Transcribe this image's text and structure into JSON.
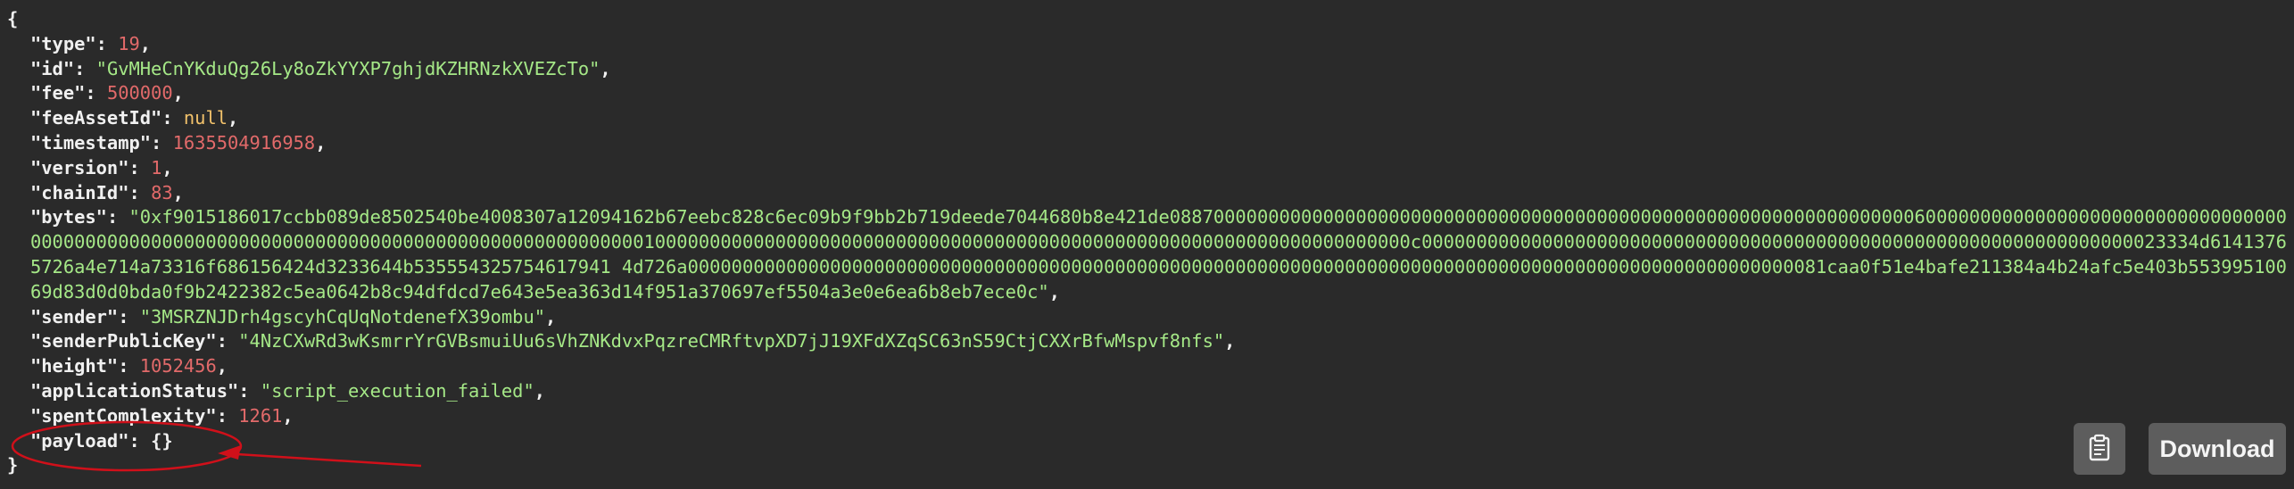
{
  "json_view": {
    "open_brace": "{",
    "close_brace": "}",
    "fields": {
      "type": {
        "key": "\"type\"",
        "value": "19"
      },
      "id": {
        "key": "\"id\"",
        "value": "\"GvMHeCnYKduQg26Ly8oZkYYXP7ghjdKZHRNzkXVEZcTo\""
      },
      "fee": {
        "key": "\"fee\"",
        "value": "500000"
      },
      "feeAssetId": {
        "key": "\"feeAssetId\"",
        "value": "null"
      },
      "timestamp": {
        "key": "\"timestamp\"",
        "value": "1635504916958"
      },
      "version": {
        "key": "\"version\"",
        "value": "1"
      },
      "chainId": {
        "key": "\"chainId\"",
        "value": "83"
      },
      "bytes": {
        "key": "\"bytes\"",
        "value": "\"0xf9015186017ccbb089de8502540be4008307a12094162b67eebc828c6ec09b9f9bb2b719deede7044680b8e421de088700000000000000000000000000000000000000000000000000000000000000006000000000000000000000000000000000000000000000000000000000000000000000000000000000000000001000000000000000000000000000000000000000000000000000000000000000000000c00000000000000000000000000000000000000000000000000000000000000000023334d61413765726a4e714a73316f686156424d3233644b535554325754617941 4d726a00000000000000000000000000000000000000000000000000000000000000000000000000000000000000000000000000000081caa0f51e4bafe211384a4b24afc5e403b55399510069d83d0d0bda0f9b2422382c5ea0642b8c94dfdcd7e643e5ea363d14f951a370697ef5504a3e0e6ea6b8eb7ece0c\""
      },
      "sender": {
        "key": "\"sender\"",
        "value": "\"3MSRZNJDrh4gscyhCqUqNotdenefX39ombu\""
      },
      "senderPublicKey": {
        "key": "\"senderPublicKey\"",
        "value": "\"4NzCXwRd3wKsmrrYrGVBsmuiUu6sVhZNKdvxPqzreCMRftvpXD7jJ19XFdXZqSC63nS59CtjCXXrBfwMspvf8nfs\""
      },
      "height": {
        "key": "\"height\"",
        "value": "1052456"
      },
      "applicationStatus": {
        "key": "\"applicationStatus\"",
        "value": "\"script_execution_failed\""
      },
      "spentComplexity": {
        "key": "\"spentComplexity\"",
        "value": "1261"
      },
      "payload": {
        "key": "\"payload\"",
        "value": "{}"
      }
    }
  },
  "toolbar": {
    "copy_icon": "clipboard-icon",
    "download_label": "Download"
  },
  "colors": {
    "background": "#2a2a2a",
    "string": "#a5e887",
    "number": "#e26a6a",
    "null": "#f2c26b",
    "annotation": "#d0101a",
    "button": "#5d5d5d"
  }
}
